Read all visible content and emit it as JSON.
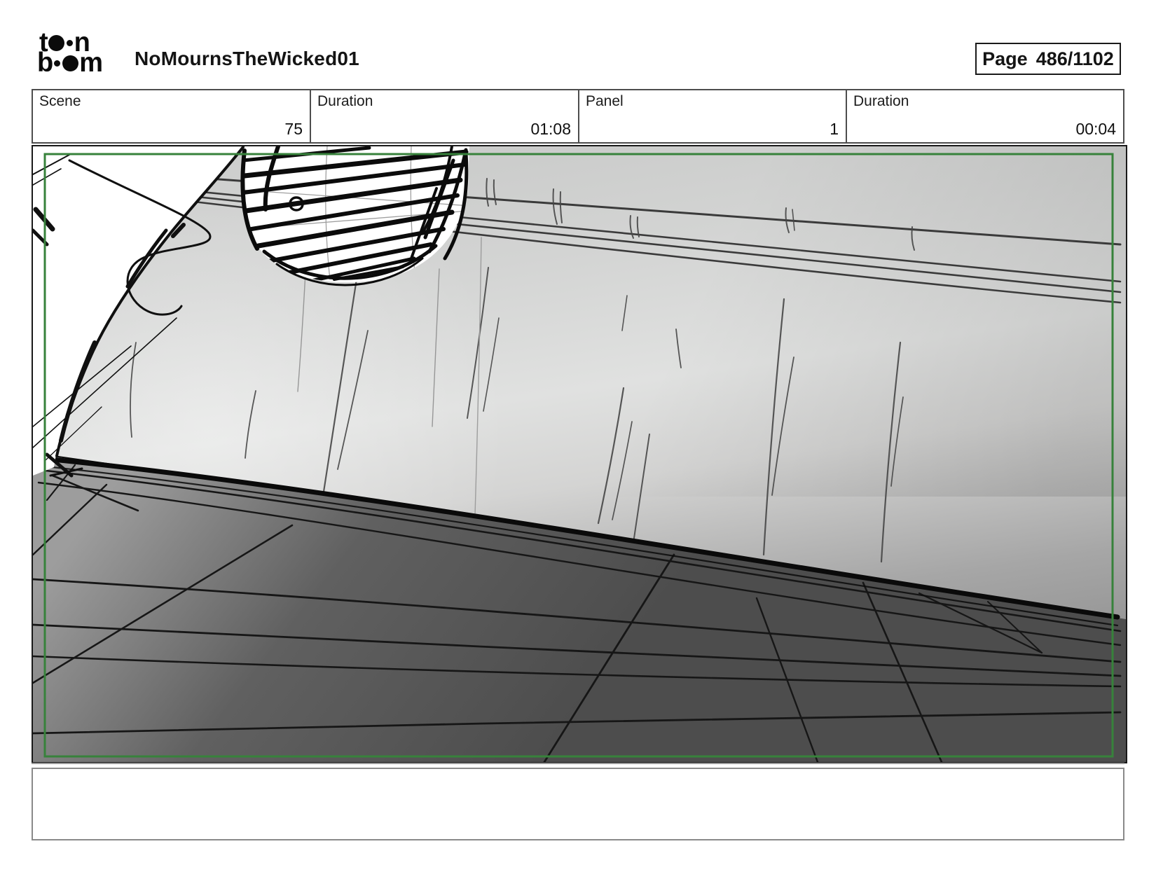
{
  "header": {
    "title": "NoMournsTheWicked01",
    "page_label": "Page",
    "page_value": "486/1102",
    "logo": {
      "t": "t",
      "n": "n",
      "b": "b",
      "m": "m"
    }
  },
  "info_row": {
    "cells": [
      {
        "label": "Scene",
        "value": "75"
      },
      {
        "label": "Duration",
        "value": "01:08"
      },
      {
        "label": "Panel",
        "value": "1"
      },
      {
        "label": "Duration",
        "value": "00:04"
      }
    ]
  },
  "panel": {
    "caption_text": "",
    "colors": {
      "camera_frame_green": "#37823b",
      "panel_border": "#191919",
      "table_border": "#4d4d4d",
      "caption_border": "#8a8a8a",
      "ink": "#0b0b0b"
    }
  }
}
